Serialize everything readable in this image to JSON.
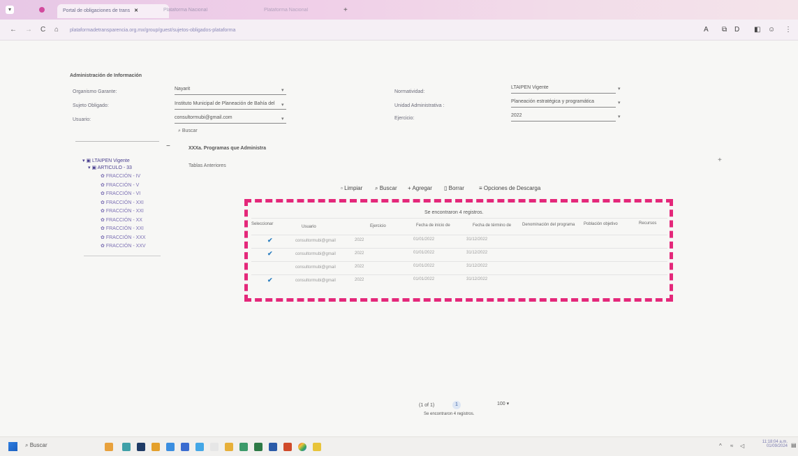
{
  "browser": {
    "tabs": [
      {
        "label": "Portal de obligaciones de trans"
      },
      {
        "label": "Plataforma Nacional"
      },
      {
        "label": "Plataforma Nacional"
      }
    ],
    "url": "plataformadetransparencia.org.mx/group/guest/sujetos-obligados-plataforma",
    "new_tab": "+"
  },
  "form": {
    "section_title": "Administración de Información",
    "labels": {
      "organismo": "Organismo Garante:",
      "sujeto": "Sujeto Obligado:",
      "usuario": "Usuario:",
      "normatividad": "Normatividad:",
      "unidad": "Unidad Administrativa :",
      "ejercicio": "Ejercicio:"
    },
    "values": {
      "organismo": "Nayarit",
      "sujeto": "Instituto Municipal de Planeación de Bahía del",
      "usuario": "consultormubi@gmail.com",
      "normatividad": "LTAIPEN Vigente",
      "unidad": "Planeación estratégica y programática",
      "ejercicio": "2022"
    },
    "search_label": "Buscar"
  },
  "panel": {
    "collapse": "−",
    "expand": "+",
    "heading": "XXXa. Programas que Administra",
    "subheading": "Tablas Anteriores"
  },
  "tree": {
    "root": "LTAIPEN Vigente",
    "article": "ARTICULO - 33",
    "items": [
      "FRACCIÓN - IV",
      "FRACCIÓN - V",
      "FRACCIÓN - VI",
      "FRACCIÓN - XXI",
      "FRACCIÓN - XXI",
      "FRACCIÓN - XX",
      "FRACCIÓN - XXI",
      "FRACCIÓN - XXX",
      "FRACCIÓN - XXV"
    ]
  },
  "toolbar": {
    "limpiar": "Limpiar",
    "buscar": "Buscar",
    "agregar": "Agregar",
    "borrar": "Borrar",
    "opciones": "Opciones de Descarga"
  },
  "table": {
    "found_text": "Se encontraron 4 registros.",
    "headers": [
      "Seleccionar",
      "Usuario",
      "Ejercicio",
      "Fecha de inicio de",
      "Fecha de término de",
      "Denominación del programa",
      "Población objetivo",
      "Recursos"
    ],
    "rows": [
      {
        "checked": true,
        "user": "consultormubi@gmail",
        "year": "2022",
        "start": "01/01/2022",
        "end": "31/12/2022"
      },
      {
        "checked": true,
        "user": "consultormubi@gmail",
        "year": "2022",
        "start": "01/01/2022",
        "end": "31/12/2022"
      },
      {
        "checked": false,
        "user": "consultormubi@gmail",
        "year": "2022",
        "start": "01/01/2022",
        "end": "31/12/2022"
      },
      {
        "checked": true,
        "user": "consultormubi@gmail",
        "year": "2022",
        "start": "01/01/2022",
        "end": "31/12/2022"
      }
    ]
  },
  "pagination": {
    "page_info": "(1 of 1)",
    "current": "1",
    "page_size": "100 ▾",
    "found_text": "Se encontraron 4 registros."
  },
  "taskbar": {
    "search_placeholder": "Buscar",
    "time": "11:18:04 a.m.",
    "date": "01/09/2024"
  },
  "colors": {
    "accent_dash": "#e4287a",
    "check": "#2c7fc0",
    "tree_link": "#7b6fb3"
  }
}
